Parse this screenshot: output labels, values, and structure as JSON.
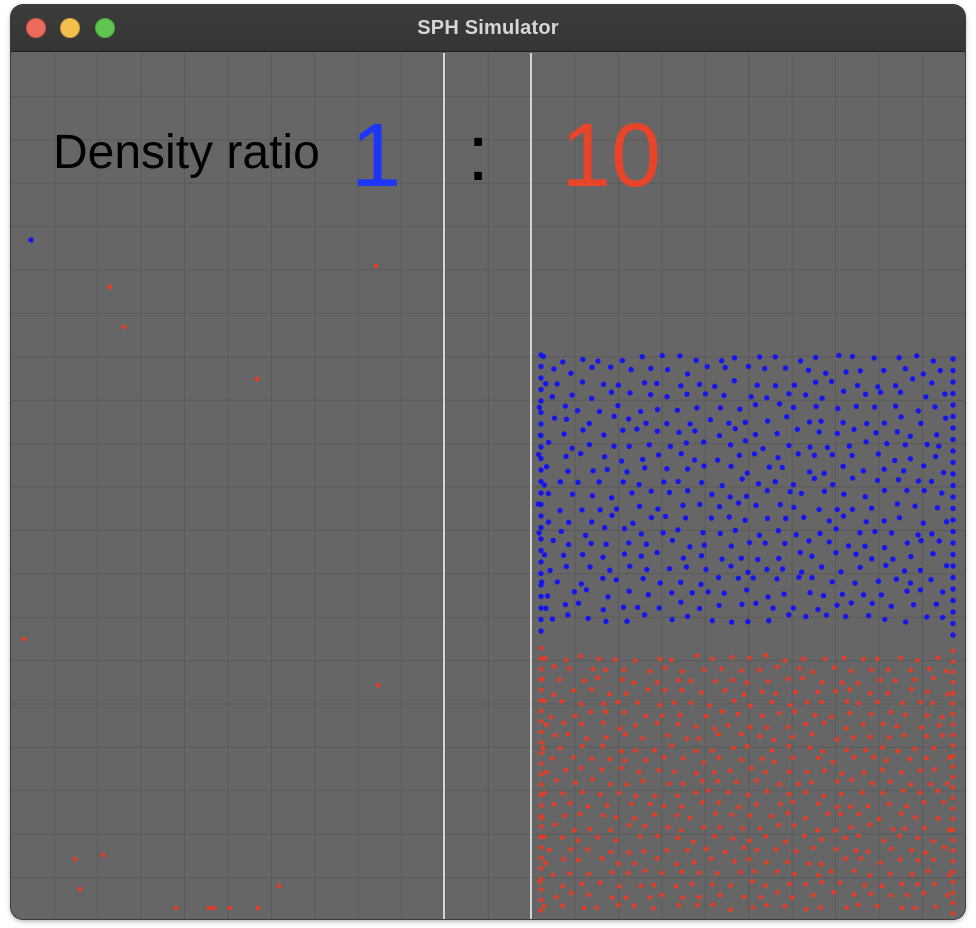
{
  "window": {
    "title": "SPH Simulator",
    "buttons": [
      "close",
      "minimize",
      "zoom"
    ],
    "background_color": "#666666",
    "grid_color": "#5a5a5a",
    "divider_color": "#f2f2f2"
  },
  "overlay": {
    "label": "Density ratio",
    "ratio_left": "1",
    "ratio_separator": ":",
    "ratio_right": "10",
    "ratio_left_color": "#1e36f5",
    "ratio_right_color": "#e8442a"
  },
  "particles": {
    "light_fluid_color": "#1515f0",
    "heavy_fluid_color": "#ea3b22",
    "light_fluid_density": 1,
    "heavy_fluid_density": 10
  }
}
